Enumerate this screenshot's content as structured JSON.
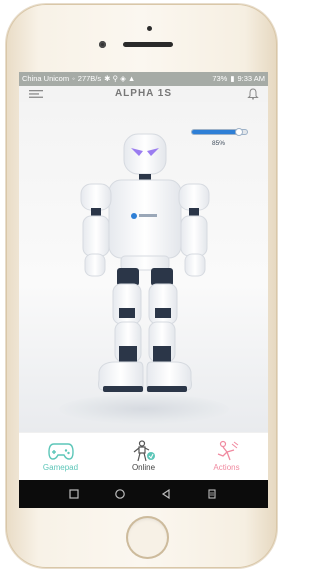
{
  "status_bar": {
    "carrier": "China Unicom",
    "speed": "277B/s",
    "battery": "73%",
    "time": "9:33 AM"
  },
  "header": {
    "title": "ALPHA 1S"
  },
  "robot_panel": {
    "battery_percent_label": "85%",
    "battery_level": 0.85
  },
  "bottom_nav": {
    "items": [
      {
        "label": "Gamepad",
        "icon": "gamepad-icon",
        "color": "#5cc6b8"
      },
      {
        "label": "Online",
        "icon": "online-robot-icon",
        "color": "#555555"
      },
      {
        "label": "Actions",
        "icon": "actions-icon",
        "color": "#f08aa0"
      }
    ]
  },
  "system_nav": [
    "square-icon",
    "circle-icon",
    "back-triangle-icon",
    "menu-icon"
  ],
  "colors": {
    "accent_blue": "#2e7fd6",
    "status_bar_bg": "#a6aba6",
    "teal": "#5cc6b8",
    "pink": "#f08aa0",
    "robot_eyes": "#9a7cf0"
  }
}
